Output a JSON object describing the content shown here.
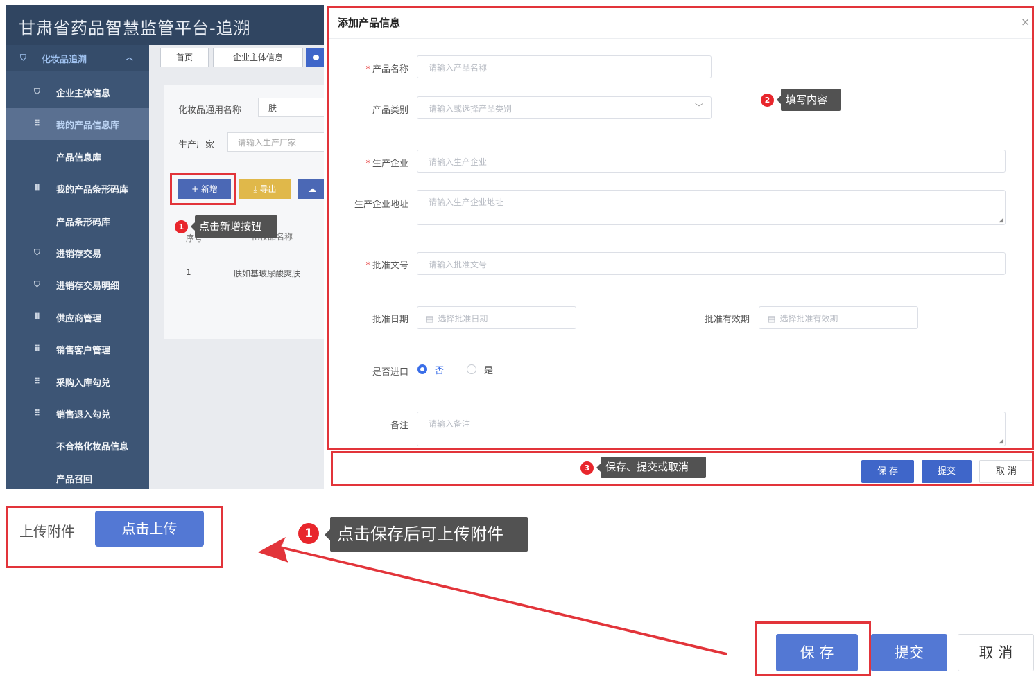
{
  "app": {
    "header_title": "甘肃省药品智慧监管平台-追溯",
    "sidebar_top": "化妆品追溯",
    "sidebar_items": [
      {
        "label": "企业主体信息",
        "icon": "shield-icon"
      },
      {
        "label": "我的产品信息库",
        "icon": "grid-icon",
        "active": true
      },
      {
        "label": "产品信息库",
        "icon": ""
      },
      {
        "label": "我的产品条形码库",
        "icon": "grid-icon"
      },
      {
        "label": "产品条形码库",
        "icon": ""
      },
      {
        "label": "进销存交易",
        "icon": "shield-icon"
      },
      {
        "label": "进销存交易明细",
        "icon": "shield-icon"
      },
      {
        "label": "供应商管理",
        "icon": "grid-icon"
      },
      {
        "label": "销售客户管理",
        "icon": "grid-icon"
      },
      {
        "label": "采购入库勾兑",
        "icon": "grid-icon"
      },
      {
        "label": "销售退入勾兑",
        "icon": "grid-icon"
      },
      {
        "label": "不合格化妆品信息",
        "icon": ""
      },
      {
        "label": "产品召回",
        "icon": ""
      }
    ],
    "tabs": [
      "首页",
      "企业主体信息"
    ],
    "filter_common_name_label": "化妆品通用名称",
    "filter_common_name_value": "肤",
    "filter_manufacturer_label": "生产厂家",
    "filter_manufacturer_placeholder": "请输入生产厂家",
    "add_button": "+ 新增",
    "export_button": "⤓ 导出",
    "table_headers": [
      "序号",
      "化妆品名称"
    ],
    "table_rows": [
      [
        "1",
        "肤如基玻尿酸爽肤"
      ]
    ]
  },
  "dialog": {
    "title": "添加产品信息",
    "close": "×",
    "fields": {
      "product_name": {
        "label": "产品名称",
        "placeholder": "请输入产品名称",
        "required": "*"
      },
      "product_category": {
        "label": "产品类别",
        "placeholder": "请输入或选择产品类别"
      },
      "manufacturer": {
        "label": "生产企业",
        "placeholder": "请输入生产企业",
        "required": "*"
      },
      "manufacturer_address": {
        "label": "生产企业地址",
        "placeholder": "请输入生产企业地址"
      },
      "approval_number": {
        "label": "批准文号",
        "placeholder": "请输入批准文号",
        "required": "*"
      },
      "approval_date": {
        "label": "批准日期",
        "placeholder": "选择批准日期"
      },
      "approval_validity": {
        "label": "批准有效期",
        "placeholder": "选择批准有效期"
      },
      "imported": {
        "label": "是否进口",
        "options": [
          "否",
          "是"
        ],
        "selected": "否"
      },
      "remarks": {
        "label": "备注",
        "placeholder": "请输入备注"
      }
    },
    "footer_buttons": {
      "save": "保 存",
      "submit": "提交",
      "cancel": "取 消"
    }
  },
  "upload": {
    "label": "上传附件",
    "button": "点击上传"
  },
  "bottom_buttons": {
    "save": "保 存",
    "submit": "提交",
    "cancel": "取 消"
  },
  "annotations": [
    {
      "number": "1",
      "text": "点击新增按钮"
    },
    {
      "number": "2",
      "text": "填写内容"
    },
    {
      "number": "3",
      "text": "保存、提交或取消"
    },
    {
      "number": "1",
      "text": "点击保存后可上传附件"
    }
  ],
  "colors": {
    "accent": "#3f66c9",
    "annotation_red": "#e2343a",
    "sidebar": "#3d5575",
    "header": "#304561"
  }
}
